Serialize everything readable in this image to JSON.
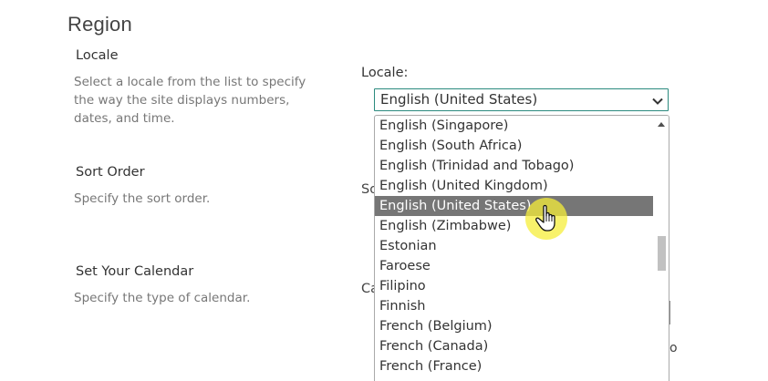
{
  "region": {
    "title": "Region"
  },
  "locale_section": {
    "title": "Locale",
    "description": "Select a locale from the list to specify the way the site displays numbers, dates, and time.",
    "field_label": "Locale:",
    "selected_value": "English (United States)",
    "options": [
      "English (Singapore)",
      "English (South Africa)",
      "English (Trinidad and Tobago)",
      "English (United Kingdom)",
      "English (United States)",
      "English (Zimbabwe)",
      "Estonian",
      "Faroese",
      "Filipino",
      "Finnish",
      "French (Belgium)",
      "French (Canada)",
      "French (France)"
    ],
    "highlighted_option": "English (United States)",
    "scroll_position": 0.45
  },
  "sort_section": {
    "title": "Sort Order",
    "description": "Specify the sort order.",
    "partial_label": "So"
  },
  "calendar_section": {
    "title": "Set Your Calendar",
    "description": "Specify the type of calendar.",
    "partial_label": "Ca",
    "partial_right_text": "or"
  },
  "icons": {
    "chevron": "chevron-down-icon",
    "scroll_up": "scroll-up-arrow-icon",
    "cursor": "hand-pointer-cursor-icon"
  },
  "colors": {
    "select_border": "#2b8a7e",
    "highlight_bg": "#767676",
    "cursor_halo": "#f5ee3a"
  }
}
